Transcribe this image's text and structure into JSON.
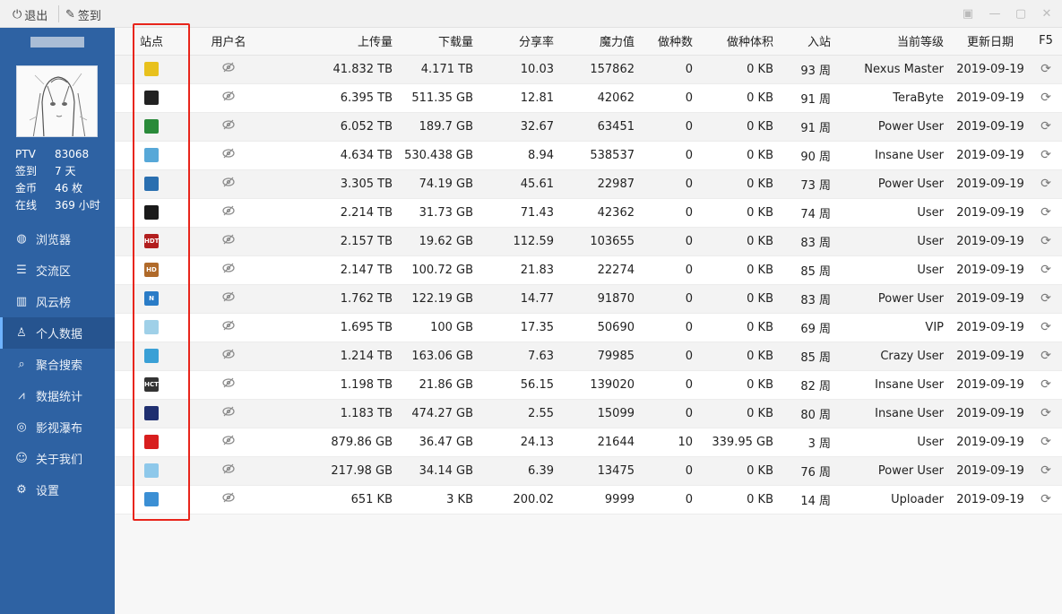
{
  "toolbar": {
    "logout_label": "退出",
    "checkin_label": "签到"
  },
  "sidebar": {
    "stats": [
      {
        "label": "PTV",
        "value": "83068"
      },
      {
        "label": "签到",
        "value": "7 天"
      },
      {
        "label": "金币",
        "value": "46 枚"
      },
      {
        "label": "在线",
        "value": "369 小时"
      }
    ],
    "menu": [
      {
        "label": "浏览器",
        "icon": "globe-icon"
      },
      {
        "label": "交流区",
        "icon": "message-icon"
      },
      {
        "label": "风云榜",
        "icon": "bar-chart-icon"
      },
      {
        "label": "个人数据",
        "icon": "user-icon",
        "active": true
      },
      {
        "label": "聚合搜索",
        "icon": "search-list-icon"
      },
      {
        "label": "数据统计",
        "icon": "line-chart-icon"
      },
      {
        "label": "影视瀑布",
        "icon": "film-reel-icon"
      },
      {
        "label": "关于我们",
        "icon": "chat-bubble-icon"
      },
      {
        "label": "设置",
        "icon": "gear-icon"
      }
    ]
  },
  "table": {
    "headers": [
      "站点",
      "用户名",
      "上传量",
      "下载量",
      "分享率",
      "魔力值",
      "做种数",
      "做种体积",
      "入站",
      "当前等级",
      "更新日期",
      "F5"
    ],
    "rows": [
      {
        "upload": "41.832 TB",
        "download": "4.171 TB",
        "ratio": "10.03",
        "bonus": "157862",
        "seeding": "0",
        "seed_size": "0 KB",
        "joined": "93 周",
        "level": "Nexus Master",
        "date": "2019-09-19"
      },
      {
        "upload": "6.395 TB",
        "download": "511.35 GB",
        "ratio": "12.81",
        "bonus": "42062",
        "seeding": "0",
        "seed_size": "0 KB",
        "joined": "91 周",
        "level": "TeraByte",
        "date": "2019-09-19"
      },
      {
        "upload": "6.052 TB",
        "download": "189.7 GB",
        "ratio": "32.67",
        "bonus": "63451",
        "seeding": "0",
        "seed_size": "0 KB",
        "joined": "91 周",
        "level": "Power User",
        "date": "2019-09-19"
      },
      {
        "upload": "4.634 TB",
        "download": "530.438 GB",
        "ratio": "8.94",
        "bonus": "538537",
        "seeding": "0",
        "seed_size": "0 KB",
        "joined": "90 周",
        "level": "Insane User",
        "date": "2019-09-19"
      },
      {
        "upload": "3.305 TB",
        "download": "74.19 GB",
        "ratio": "45.61",
        "bonus": "22987",
        "seeding": "0",
        "seed_size": "0 KB",
        "joined": "73 周",
        "level": "Power User",
        "date": "2019-09-19"
      },
      {
        "upload": "2.214 TB",
        "download": "31.73 GB",
        "ratio": "71.43",
        "bonus": "42362",
        "seeding": "0",
        "seed_size": "0 KB",
        "joined": "74 周",
        "level": "User",
        "date": "2019-09-19"
      },
      {
        "upload": "2.157 TB",
        "download": "19.62 GB",
        "ratio": "112.59",
        "bonus": "103655",
        "seeding": "0",
        "seed_size": "0 KB",
        "joined": "83 周",
        "level": "User",
        "date": "2019-09-19"
      },
      {
        "upload": "2.147 TB",
        "download": "100.72 GB",
        "ratio": "21.83",
        "bonus": "22274",
        "seeding": "0",
        "seed_size": "0 KB",
        "joined": "85 周",
        "level": "User",
        "date": "2019-09-19"
      },
      {
        "upload": "1.762 TB",
        "download": "122.19 GB",
        "ratio": "14.77",
        "bonus": "91870",
        "seeding": "0",
        "seed_size": "0 KB",
        "joined": "83 周",
        "level": "Power User",
        "date": "2019-09-19"
      },
      {
        "upload": "1.695 TB",
        "download": "100 GB",
        "ratio": "17.35",
        "bonus": "50690",
        "seeding": "0",
        "seed_size": "0 KB",
        "joined": "69 周",
        "level": "VIP",
        "date": "2019-09-19"
      },
      {
        "upload": "1.214 TB",
        "download": "163.06 GB",
        "ratio": "7.63",
        "bonus": "79985",
        "seeding": "0",
        "seed_size": "0 KB",
        "joined": "85 周",
        "level": "Crazy User",
        "date": "2019-09-19"
      },
      {
        "upload": "1.198 TB",
        "download": "21.86 GB",
        "ratio": "56.15",
        "bonus": "139020",
        "seeding": "0",
        "seed_size": "0 KB",
        "joined": "82 周",
        "level": "Insane User",
        "date": "2019-09-19"
      },
      {
        "upload": "1.183 TB",
        "download": "474.27 GB",
        "ratio": "2.55",
        "bonus": "15099",
        "seeding": "0",
        "seed_size": "0 KB",
        "joined": "80 周",
        "level": "Insane User",
        "date": "2019-09-19"
      },
      {
        "upload": "879.86 GB",
        "download": "36.47 GB",
        "ratio": "24.13",
        "bonus": "21644",
        "seeding": "10",
        "seed_size": "339.95 GB",
        "joined": "3 周",
        "level": "User",
        "date": "2019-09-19"
      },
      {
        "upload": "217.98 GB",
        "download": "34.14 GB",
        "ratio": "6.39",
        "bonus": "13475",
        "seeding": "0",
        "seed_size": "0 KB",
        "joined": "76 周",
        "level": "Power User",
        "date": "2019-09-19"
      },
      {
        "upload": "651 KB",
        "download": "3 KB",
        "ratio": "200.02",
        "bonus": "9999",
        "seeding": "0",
        "seed_size": "0 KB",
        "joined": "14 周",
        "level": "Uploader",
        "date": "2019-09-19"
      }
    ]
  },
  "site_icons": [
    {
      "bg": "#e8c11d",
      "glyph": "",
      "name": "site-icon-1"
    },
    {
      "bg": "#222222",
      "glyph": "",
      "name": "site-icon-2"
    },
    {
      "bg": "#2a8a3a",
      "glyph": "",
      "name": "site-icon-3"
    },
    {
      "bg": "#57a8d8",
      "glyph": "",
      "name": "site-icon-4"
    },
    {
      "bg": "#2a6fb0",
      "glyph": "",
      "name": "site-icon-5"
    },
    {
      "bg": "#1a1a1a",
      "glyph": "",
      "name": "site-icon-6"
    },
    {
      "bg": "#b21e1e",
      "glyph": "HDT",
      "name": "site-icon-7"
    },
    {
      "bg": "#b06a2a",
      "glyph": "HD",
      "name": "site-icon-8"
    },
    {
      "bg": "#2a7cc7",
      "glyph": "N",
      "name": "site-icon-9"
    },
    {
      "bg": "#9fd0e8",
      "glyph": "",
      "name": "site-icon-10"
    },
    {
      "bg": "#3aa0d6",
      "glyph": "",
      "name": "site-icon-11"
    },
    {
      "bg": "#333333",
      "glyph": "HCT",
      "name": "site-icon-12"
    },
    {
      "bg": "#1f2f70",
      "glyph": "",
      "name": "site-icon-13"
    },
    {
      "bg": "#d81e1e",
      "glyph": "",
      "name": "site-icon-14"
    },
    {
      "bg": "#8ec8ea",
      "glyph": "",
      "name": "site-icon-15"
    },
    {
      "bg": "#3b8fd4",
      "glyph": "",
      "name": "site-icon-16"
    }
  ]
}
